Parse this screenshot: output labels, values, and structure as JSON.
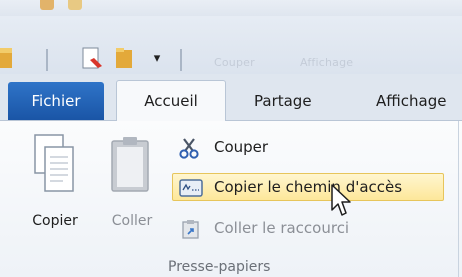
{
  "quick_access": {
    "dropdown_glyph": "▾",
    "faded_tabs": [
      "Couper",
      "Affichage"
    ]
  },
  "tabs": {
    "fichier": "Fichier",
    "accueil": "Accueil",
    "partage": "Partage",
    "affichage": "Affichage"
  },
  "ribbon": {
    "copier": "Copier",
    "coller": "Coller",
    "couper": "Couper",
    "copier_chemin": "Copier le chemin d'accès",
    "coller_raccourci": "Coller le raccourci",
    "group_label": "Presse-papiers"
  },
  "colors": {
    "fichier_tab": "#1a55a6",
    "hover_highlight": "#fde79a",
    "disabled_text": "#8b8f96"
  }
}
